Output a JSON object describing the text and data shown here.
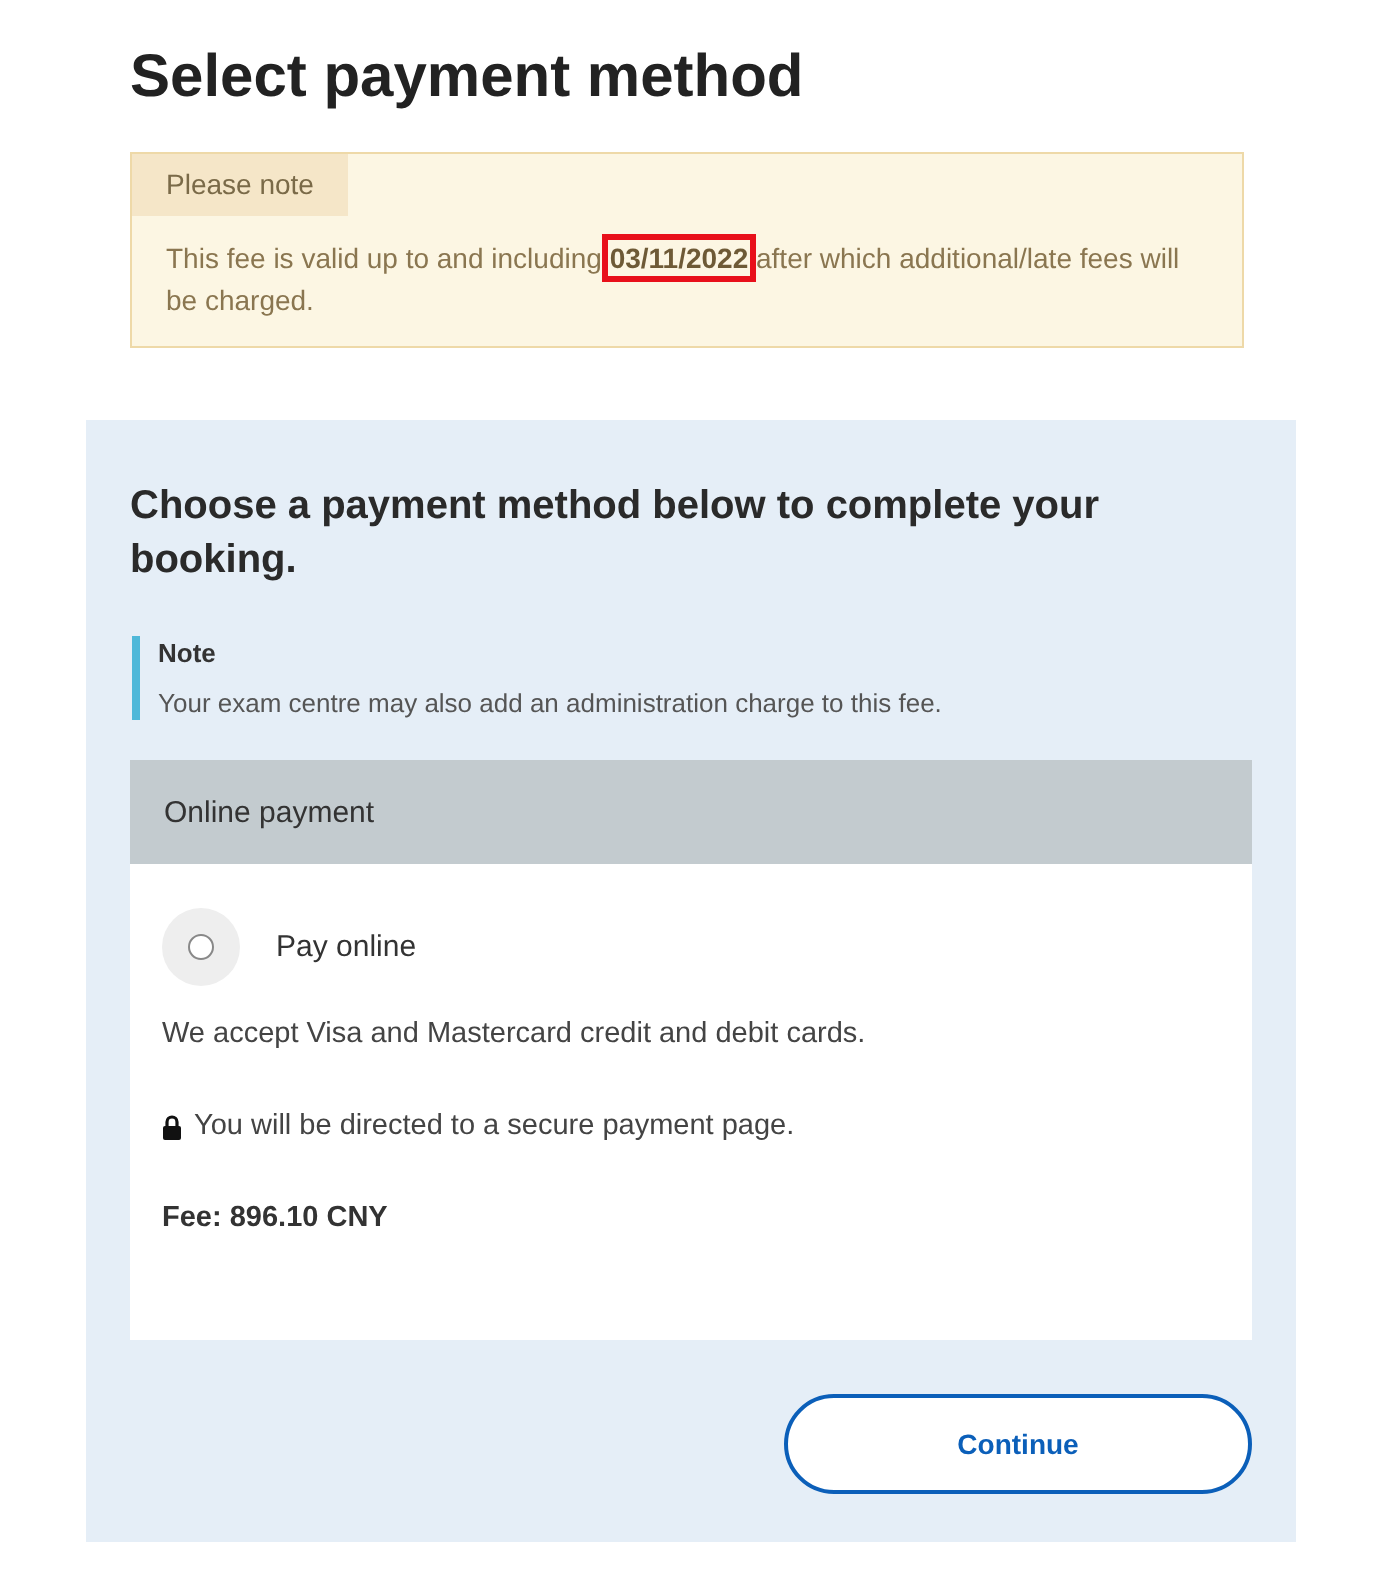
{
  "page_title": "Select payment method",
  "notice": {
    "title": "Please note",
    "text": "This fee is valid up to and including **03/11/2022** after which additional/late fees will be charged.",
    "highlighted": true
  },
  "panel": {
    "heading": "Choose a payment method below to complete your booking.",
    "note": {
      "title": "Note",
      "text": "Your exam centre may also add an administration charge to this fee."
    },
    "section": {
      "title": "Online payment",
      "option": {
        "label": "Pay online",
        "selected": false
      },
      "accept_text": "We accept Visa and Mastercard credit and debit cards.",
      "secure_text": "You will be directed to a secure payment page.",
      "fee": "Fee: 896.10 CNY"
    },
    "button": "Continue"
  }
}
